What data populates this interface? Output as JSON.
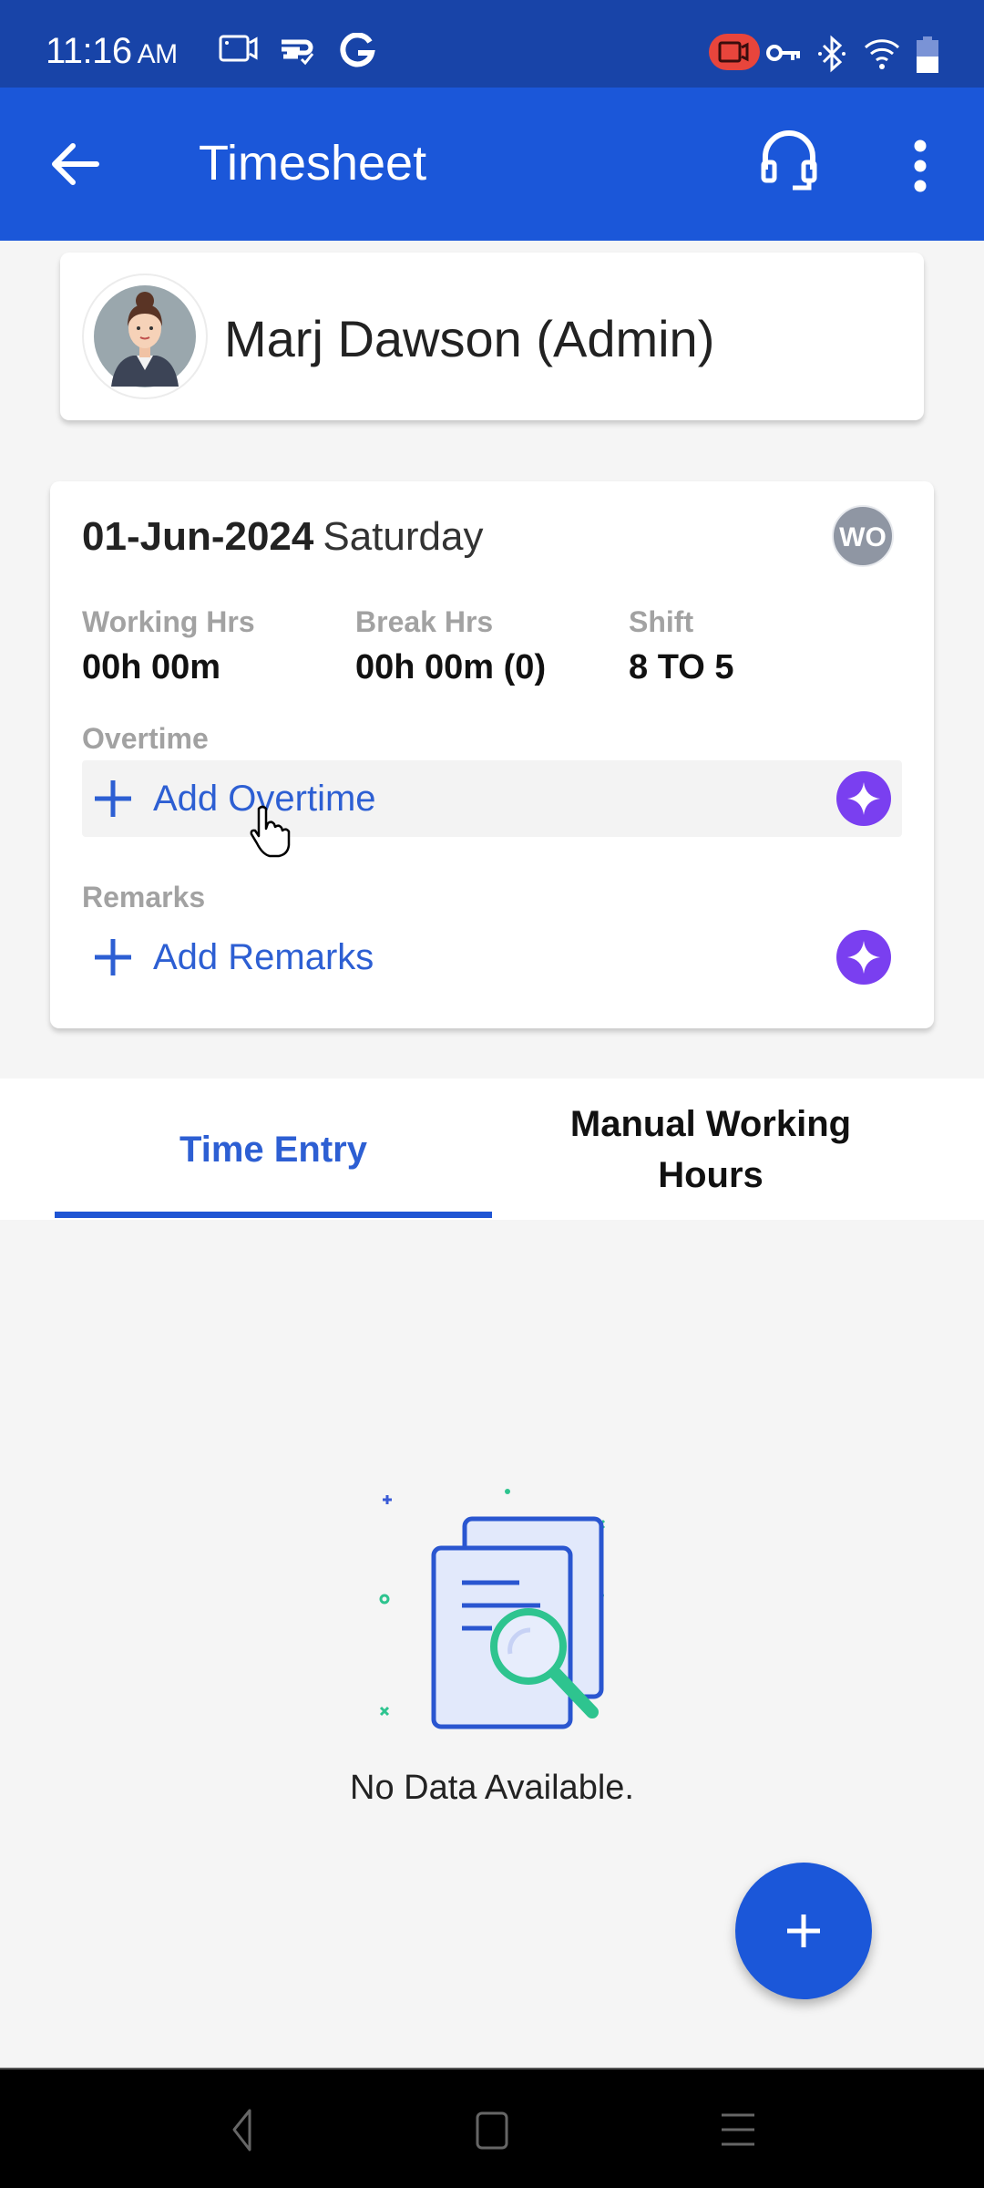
{
  "status_bar": {
    "time": "11:16",
    "ampm": "AM",
    "left_icons": [
      "screen-record-icon",
      "sync-check-icon",
      "google-icon"
    ],
    "right_icons": [
      "recording-indicator-icon",
      "vpn-key-icon",
      "bluetooth-icon",
      "wifi-icon",
      "battery-icon"
    ],
    "recording_color": "#e8453c"
  },
  "app_bar": {
    "title": "Timesheet",
    "back_icon": "arrow-left-icon",
    "support_icon": "headset-icon",
    "menu_icon": "more-vertical-icon",
    "color": "#1b57d9"
  },
  "user": {
    "name": "Marj Dawson (Admin)"
  },
  "day": {
    "date": "01-Jun-2024",
    "weekday": "Saturday",
    "badge": "WO",
    "stats": [
      {
        "label": "Working Hrs",
        "value": "00h 00m"
      },
      {
        "label": "Break Hrs",
        "value": "00h 00m (0)"
      },
      {
        "label": "Shift",
        "value": "8 TO 5"
      }
    ],
    "overtime": {
      "label": "Overtime",
      "action": "Add Overtime"
    },
    "remarks": {
      "label": "Remarks",
      "action": "Add Remarks"
    },
    "accent": "#2d5fd3",
    "ai_color": "#7a3ff0"
  },
  "tabs": [
    {
      "label": "Time Entry",
      "active": true
    },
    {
      "label": "Manual Working Hours",
      "active": false
    }
  ],
  "empty_state": {
    "icon": "document-search-icon",
    "text": "No Data Available."
  },
  "fab": {
    "icon": "plus-icon"
  },
  "nav_bar": {
    "buttons": [
      "back-nav-icon",
      "home-nav-icon",
      "recents-nav-icon"
    ]
  }
}
